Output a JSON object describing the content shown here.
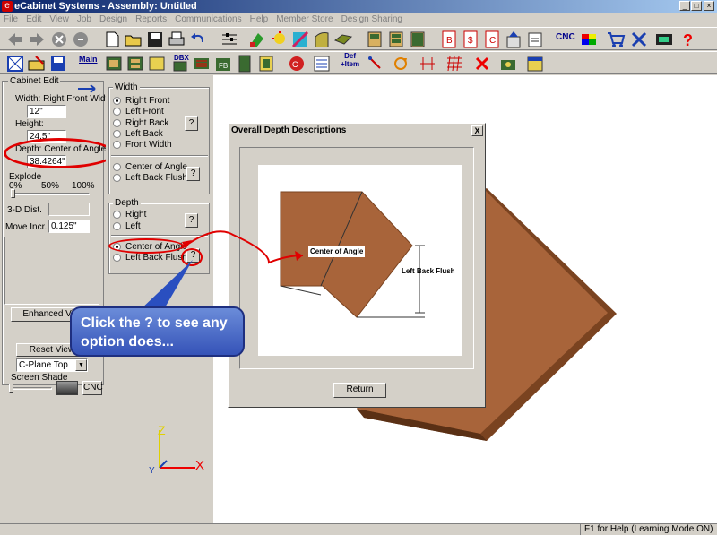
{
  "app": {
    "title": "eCabinet Systems - Assembly: Untitled",
    "icon": "e"
  },
  "menu": [
    "File",
    "Edit",
    "View",
    "Job",
    "Design",
    "Reports",
    "Communications",
    "Help",
    "Member Store",
    "Design Sharing"
  ],
  "toolbar": {
    "cnc_label": "CNC",
    "main_label": "Main",
    "dbx_label": "DBX",
    "def_label": "Def",
    "item_label": "+Item"
  },
  "left_panel": {
    "group_title": "Cabinet Edit",
    "width_label": "Width: Right Front Width",
    "width_value": "12\"",
    "height_label": "Height:",
    "height_value": "24.5\"",
    "depth_label": "Depth: Center of Angle",
    "depth_value": "38.4264\"",
    "explode_label": "Explode",
    "explode_ticks": [
      "0%",
      "50%",
      "100%"
    ],
    "dist_label": "3-D Dist.",
    "move_label": "Move Incr.",
    "move_value": "0.125\"",
    "enhanced_view": "Enhanced View",
    "reset_view": "Reset View",
    "plane_value": "C-Plane Top",
    "screen_shade": "Screen Shade",
    "cnc": "CNC"
  },
  "options_panel": {
    "width_title": "Width",
    "width_options": [
      "Right Front",
      "Left Front",
      "Right Back",
      "Left Back",
      "Front Width"
    ],
    "width_selected": 0,
    "angle_options": [
      "Center of Angle",
      "Left Back Flush"
    ],
    "depth_title": "Depth",
    "depth_options": [
      "Right",
      "Left"
    ],
    "depth_angle_options": [
      "Center of Angle",
      "Left Back Flush"
    ],
    "depth_angle_selected": 0,
    "help": "?"
  },
  "dialog": {
    "title": "Overall Depth Descriptions",
    "label_center": "Center of Angle",
    "label_flush": "Left Back Flush",
    "return": "Return",
    "close": "X"
  },
  "callout": {
    "text": "Click the ? to see any option does..."
  },
  "axes": {
    "x": "X",
    "y": "Y",
    "z": "Z"
  },
  "status": {
    "help": "F1 for Help (Learning Mode ON)"
  },
  "colors": {
    "wood": "#a8643a",
    "wood_dark": "#7a4320",
    "highlight": "#e00000",
    "accent_blue": "#2a4fc0"
  }
}
